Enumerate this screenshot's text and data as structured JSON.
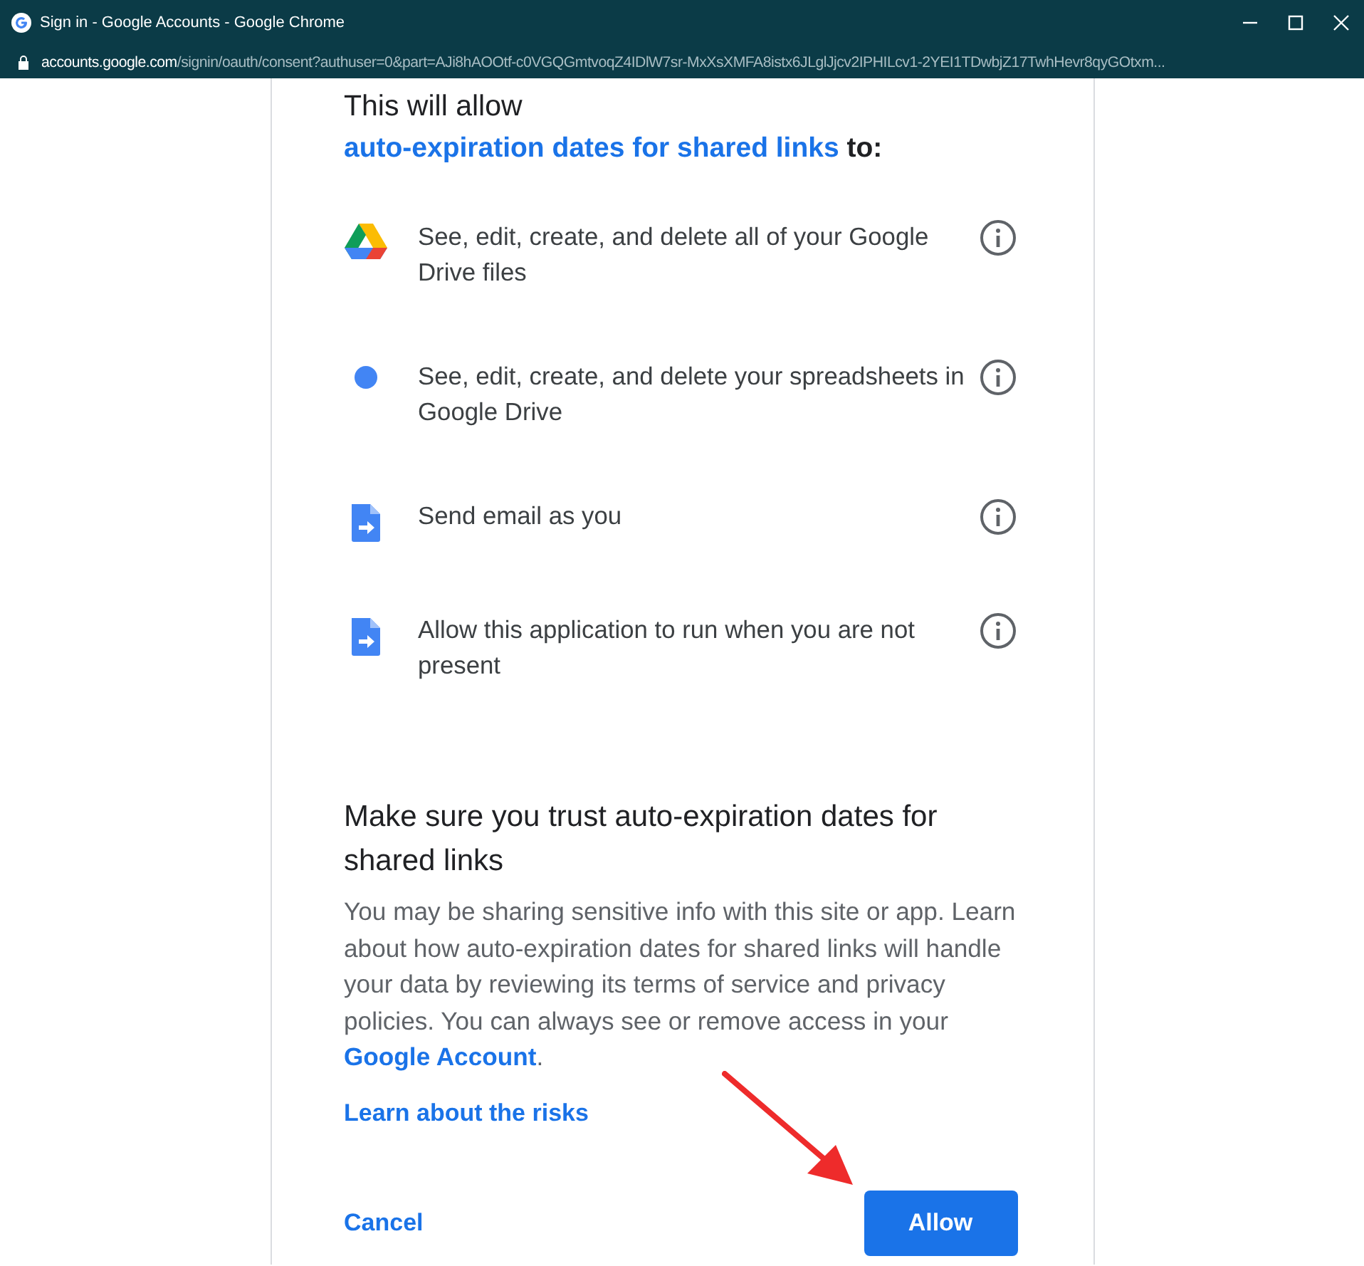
{
  "window": {
    "title": "Sign in - Google Accounts - Google Chrome",
    "url_host": "accounts.google.com",
    "url_path": "/signin/oauth/consent?authuser=0&part=AJi8hAOOtf-c0VGQGmtvoqZ4IDlW7sr-MxXsXMFA8istx6JLglJjcv2IPHILcv1-2YEI1TDwbjZ17TwhHevr8qyGOtxm..."
  },
  "consent": {
    "intro": "This will allow",
    "app_name": "auto-expiration dates for shared links",
    "intro_suffix": " to:",
    "permissions": [
      {
        "kind": "drive",
        "text": "See, edit, create, and delete all of your Google Drive files"
      },
      {
        "kind": "dot",
        "text": "See, edit, create, and delete your spreadsheets in Google Drive"
      },
      {
        "kind": "script",
        "text": "Send email as you"
      },
      {
        "kind": "script",
        "text": "Allow this application to run when you are not present"
      }
    ],
    "trust_heading": "Make sure you trust auto-expiration dates for shared links",
    "trust_text": "You may be sharing sensitive info with this site or app. Learn about how auto-expiration dates for shared links will handle your data by reviewing its terms of service and privacy policies. You can always see or remove access in your ",
    "account_link": "Google Account",
    "trust_end": ".",
    "risks_link": "Learn about the risks",
    "buttons": {
      "cancel": "Cancel",
      "allow": "Allow"
    }
  }
}
